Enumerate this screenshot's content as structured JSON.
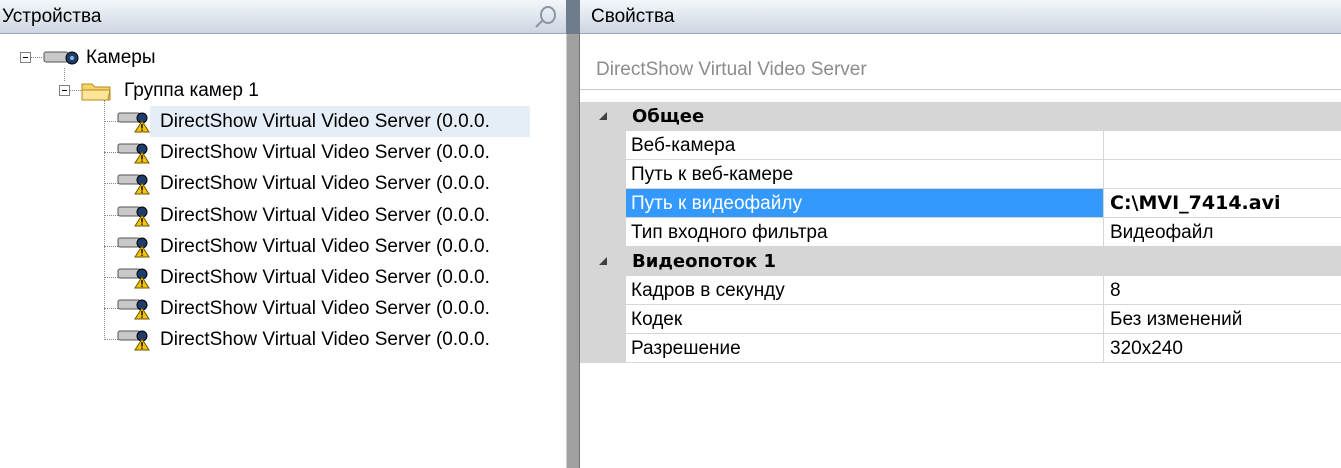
{
  "devices_panel": {
    "title": "Устройства",
    "tree": {
      "root_label": "Камеры",
      "group_label": "Группа камер 1",
      "servers": [
        {
          "label": "DirectShow Virtual Video Server (0.0.0."
        },
        {
          "label": "DirectShow Virtual Video Server (0.0.0."
        },
        {
          "label": "DirectShow Virtual Video Server (0.0.0."
        },
        {
          "label": "DirectShow Virtual Video Server (0.0.0."
        },
        {
          "label": "DirectShow Virtual Video Server (0.0.0."
        },
        {
          "label": "DirectShow Virtual Video Server (0.0.0."
        },
        {
          "label": "DirectShow Virtual Video Server (0.0.0."
        },
        {
          "label": "DirectShow Virtual Video Server (0.0.0."
        }
      ]
    }
  },
  "properties_panel": {
    "title": "Свойства",
    "selected_object": "DirectShow Virtual Video Server",
    "categories": [
      {
        "name": "Общее",
        "rows": [
          {
            "name": "Веб-камера",
            "value": ""
          },
          {
            "name": "Путь к веб-камере",
            "value": ""
          },
          {
            "name": "Путь к видеофайлу",
            "value": "C:\\MVI_7414.avi"
          },
          {
            "name": "Тип входного фильтра",
            "value": "Видеофайл"
          }
        ]
      },
      {
        "name": "Видеопоток 1",
        "rows": [
          {
            "name": "Кадров в секунду",
            "value": "8"
          },
          {
            "name": "Кодек",
            "value": "Без изменений"
          },
          {
            "name": "Разрешение",
            "value": "320x240"
          }
        ]
      }
    ]
  },
  "colors": {
    "selection": "#3399ff",
    "category_bg": "#d6d6d6",
    "tree_selection": "#e5eef7"
  }
}
